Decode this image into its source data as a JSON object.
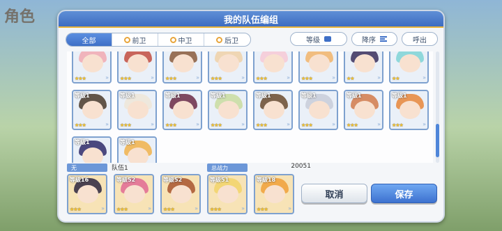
{
  "background": {
    "title": "角色"
  },
  "dialog": {
    "title": "我的队伍编组"
  },
  "filters": {
    "tabs": [
      {
        "label": "全部"
      },
      {
        "label": "前卫"
      },
      {
        "label": "中卫"
      },
      {
        "label": "后卫"
      }
    ],
    "level_label": "等级",
    "sort_label": "降序",
    "call_label": "呼出"
  },
  "roster": [
    {
      "level": "",
      "stars": "★★★",
      "hair": "#f1a9b2"
    },
    {
      "level": "",
      "stars": "★★★",
      "hair": "#c24c3f"
    },
    {
      "level": "",
      "stars": "★★★",
      "hair": "#8a5a3b"
    },
    {
      "level": "",
      "stars": "★★★",
      "hair": "#f0d1a8"
    },
    {
      "level": "",
      "stars": "★★★",
      "hair": "#f7c9d6"
    },
    {
      "level": "",
      "stars": "★★★",
      "hair": "#f2b46a"
    },
    {
      "level": "",
      "stars": "★★",
      "hair": "#3a2f5c"
    },
    {
      "level": "",
      "stars": "★★",
      "hair": "#7fd3d6"
    },
    {
      "level": "等级1",
      "stars": "★★★",
      "hair": "#4a3a2a"
    },
    {
      "level": "等级1",
      "stars": "★★★",
      "hair": "#efe6d8"
    },
    {
      "level": "等级1",
      "stars": "★★★",
      "hair": "#6b2a45"
    },
    {
      "level": "等级1",
      "stars": "★★★",
      "hair": "#c9dca0"
    },
    {
      "level": "等级1",
      "stars": "★★★",
      "hair": "#6a4a2e"
    },
    {
      "level": "等级1",
      "stars": "★★★",
      "hair": "#c8cdd9"
    },
    {
      "level": "等级1",
      "stars": "★★★",
      "hair": "#d27a4a"
    },
    {
      "level": "等级1",
      "stars": "★★★",
      "hair": "#e8863a"
    },
    {
      "level": "等级1",
      "stars": "★★★",
      "hair": "#2f2a6a"
    },
    {
      "level": "等级1",
      "stars": "★★★",
      "hair": "#f1b24a"
    }
  ],
  "team": {
    "status_tag": "无",
    "name": "队伍1",
    "power_label": "总战力",
    "power_value": "20051",
    "members": [
      {
        "level": "等级16",
        "stars": "★★★",
        "hair": "#2b2540"
      },
      {
        "level": "等级52",
        "stars": "★★★",
        "hair": "#e06a94"
      },
      {
        "level": "等级52",
        "stars": "★★★",
        "hair": "#a8532e"
      },
      {
        "level": "等级51",
        "stars": "★★★",
        "hair": "#f2d36a"
      },
      {
        "level": "等级18",
        "stars": "★★★",
        "hair": "#f0a03a"
      }
    ]
  },
  "buttons": {
    "cancel": "取消",
    "save": "保存"
  }
}
